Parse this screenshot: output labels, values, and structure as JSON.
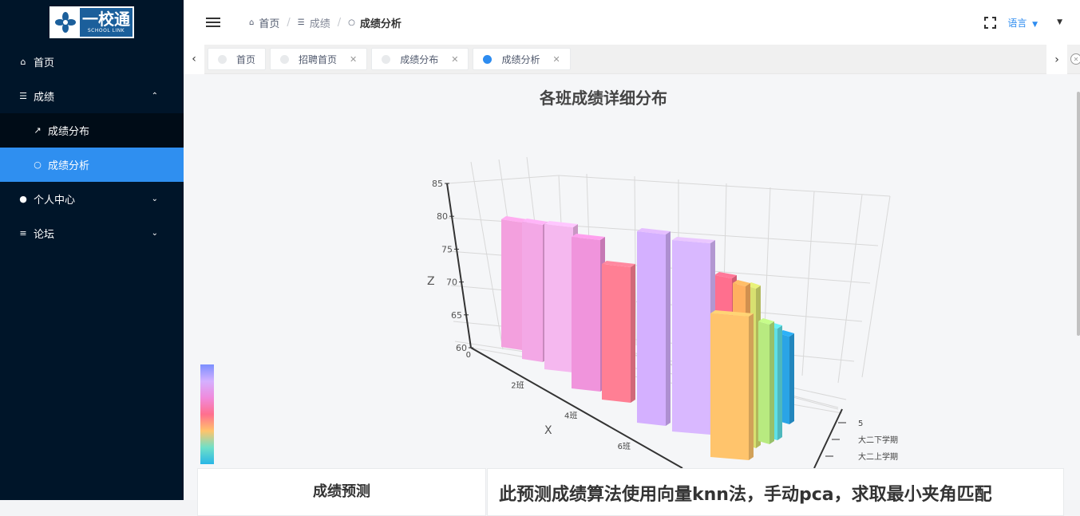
{
  "logo": {
    "main_text": "一校通",
    "sub_text": "SCHOOL LINK"
  },
  "sidebar": {
    "home": "首页",
    "grades": "成绩",
    "grade_distribution": "成绩分布",
    "grade_analysis": "成绩分析",
    "personal_center": "个人中心",
    "forum": "论坛"
  },
  "breadcrumb": [
    "首页",
    "成绩",
    "成绩分析"
  ],
  "header": {
    "language": "语言"
  },
  "tabs": [
    "首页",
    "招聘首页",
    "成绩分布",
    "成绩分析"
  ],
  "chart_data": {
    "type": "bar3d",
    "title": "各班成绩详细分布",
    "xlabel": "X",
    "ylabel": "",
    "zlabel": "Z",
    "x_tick_labels": [
      "0",
      "2班",
      "4班",
      "6班"
    ],
    "y_tick_labels": [
      "5",
      "大二下学期",
      "大二上学期"
    ],
    "z_ticks": [
      60,
      65,
      70,
      75,
      80,
      85
    ],
    "zlim": [
      60,
      85
    ],
    "bars": [
      {
        "value": 80,
        "color": "#f3a0de"
      },
      {
        "value": 80,
        "color": "#f3a8e6"
      },
      {
        "value": 80,
        "color": "#f5b8ef"
      },
      {
        "value": 78,
        "color": "#f094dc"
      },
      {
        "value": 76,
        "color": "#ff7f94"
      },
      {
        "value": 79,
        "color": "#d4b0ff"
      },
      {
        "value": 78,
        "color": "#d9b8ff"
      },
      {
        "value": 75,
        "color": "#ff6f8e"
      },
      {
        "value": 74,
        "color": "#ffb060"
      },
      {
        "value": 73,
        "color": "#d8e070"
      },
      {
        "value": 72,
        "color": "#ffc46c"
      },
      {
        "value": 71,
        "color": "#b8ea80"
      },
      {
        "value": 70,
        "color": "#5fe0e6"
      },
      {
        "value": 69,
        "color": "#2aa4e6"
      }
    ],
    "visual_map_colors": [
      "#7b8fff",
      "#d4b0ff",
      "#f08adc",
      "#ff6f8e",
      "#ffc46c",
      "#6fe0c8",
      "#29b6e6"
    ]
  },
  "cards": {
    "prediction_title": "成绩预测",
    "algorithm_text": "此预测成绩算法使用向量knn法，手动pca，求取最小夹角匹配"
  }
}
